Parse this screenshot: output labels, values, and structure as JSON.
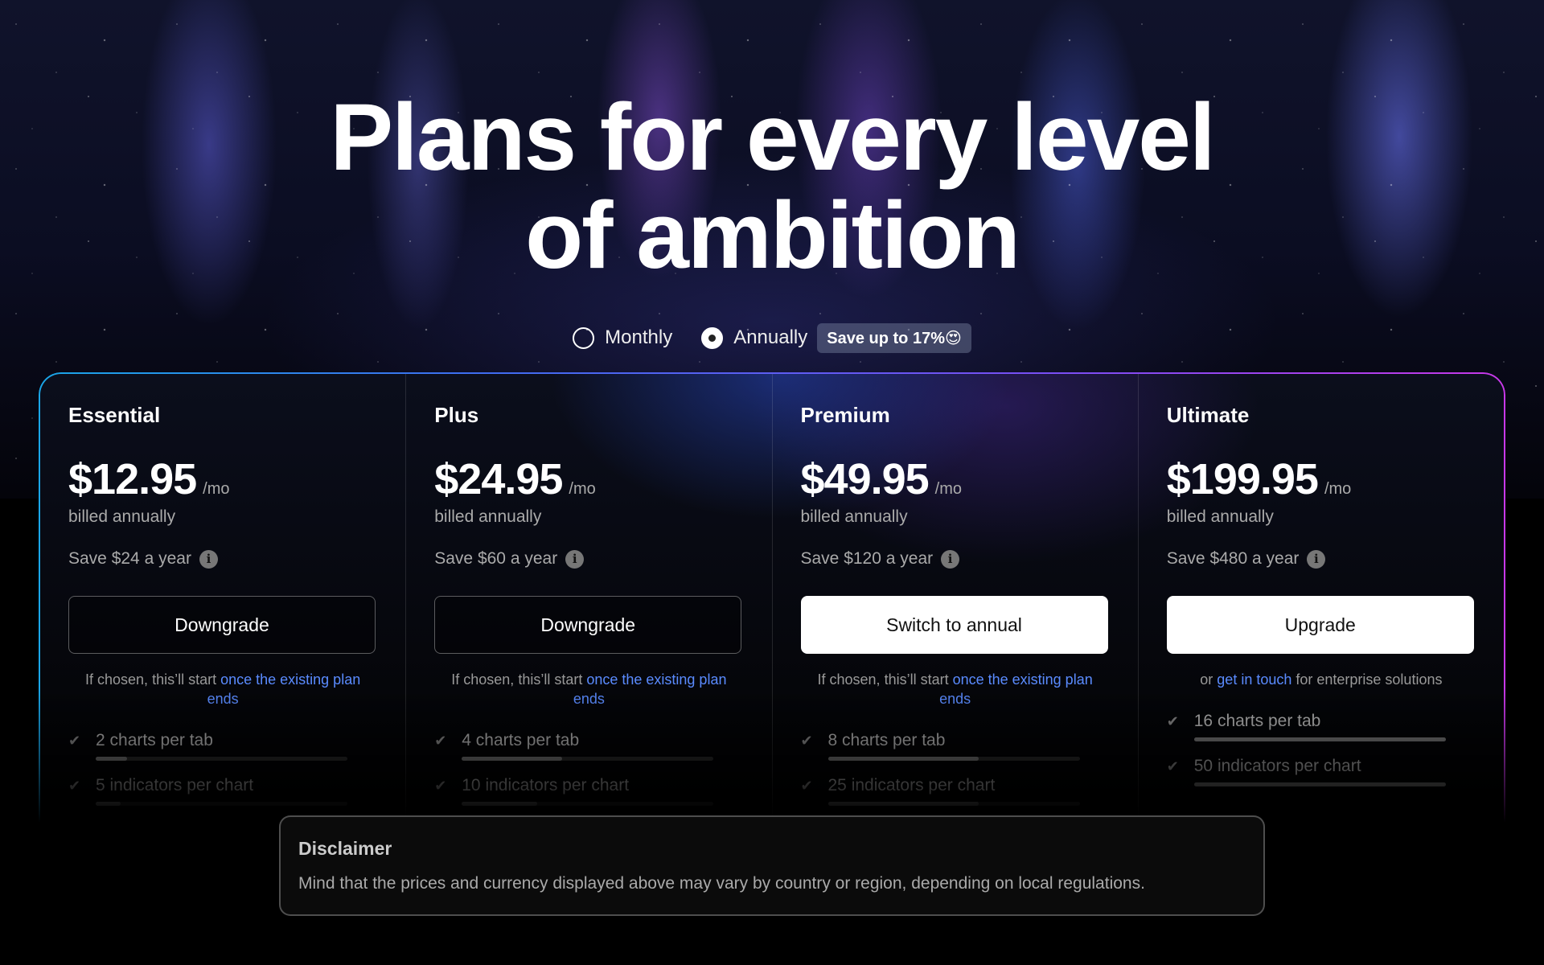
{
  "hero": {
    "title_line1": "Plans for every level",
    "title_line2": "of ambition"
  },
  "billing": {
    "monthly_label": "Monthly",
    "annually_label": "Annually",
    "selected": "Annually",
    "save_badge": "Save up to 17%😍"
  },
  "plans": [
    {
      "name": "Essential",
      "price": "$12.95",
      "per": "/mo",
      "billed": "billed annually",
      "save": "Save $24 a year",
      "cta": "Downgrade",
      "cta_style": "outline",
      "note_prefix": "If chosen, this’ll start ",
      "note_link": "once the existing plan ends",
      "note_suffix": "",
      "features": [
        {
          "text": "2 charts per tab",
          "level": 0.125
        },
        {
          "text": "5 indicators per chart",
          "level": 0.1
        }
      ]
    },
    {
      "name": "Plus",
      "price": "$24.95",
      "per": "/mo",
      "billed": "billed annually",
      "save": "Save $60 a year",
      "cta": "Downgrade",
      "cta_style": "outline",
      "note_prefix": "If chosen, this’ll start ",
      "note_link": "once the existing plan ends",
      "note_suffix": "",
      "features": [
        {
          "text": "4 charts per tab",
          "level": 0.4
        },
        {
          "text": "10 indicators per chart",
          "level": 0.3
        }
      ]
    },
    {
      "name": "Premium",
      "price": "$49.95",
      "per": "/mo",
      "billed": "billed annually",
      "save": "Save $120 a year",
      "cta": "Switch to annual",
      "cta_style": "solid",
      "note_prefix": "If chosen, this’ll start ",
      "note_link": "once the existing plan ends",
      "note_suffix": "",
      "features": [
        {
          "text": "8 charts per tab",
          "level": 0.6
        },
        {
          "text": "25 indicators per chart",
          "level": 0.6
        }
      ]
    },
    {
      "name": "Ultimate",
      "price": "$199.95",
      "per": "/mo",
      "billed": "billed annually",
      "save": "Save $480 a year",
      "cta": "Upgrade",
      "cta_style": "solid",
      "note_prefix": "or ",
      "note_link": "get in touch",
      "note_suffix": " for enterprise solutions",
      "features": [
        {
          "text": "16 charts per tab",
          "level": 1.0
        },
        {
          "text": "50 indicators per chart",
          "level": 1.0
        }
      ]
    }
  ],
  "disclaimer": {
    "title": "Disclaimer",
    "text": "Mind that the prices and currency displayed above may vary by country or region, depending on local regulations."
  }
}
